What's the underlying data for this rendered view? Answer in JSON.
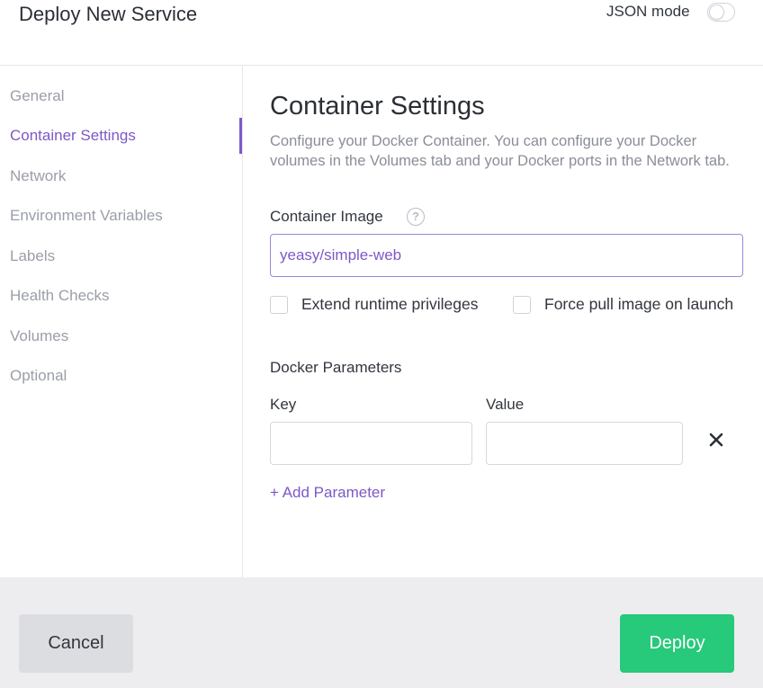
{
  "header": {
    "title": "Deploy New Service",
    "json_mode_label": "JSON mode",
    "json_mode_enabled": false
  },
  "sidebar": {
    "items": [
      {
        "label": "General",
        "active": false
      },
      {
        "label": "Container Settings",
        "active": true
      },
      {
        "label": "Network",
        "active": false
      },
      {
        "label": "Environment Variables",
        "active": false
      },
      {
        "label": "Labels",
        "active": false
      },
      {
        "label": "Health Checks",
        "active": false
      },
      {
        "label": "Volumes",
        "active": false
      },
      {
        "label": "Optional",
        "active": false
      }
    ],
    "accent_color": "#7d58c7"
  },
  "main": {
    "title": "Container Settings",
    "description": "Configure your Docker Container. You can configure your Docker volumes in the Volumes tab and your Docker ports in the Network tab.",
    "container_image": {
      "label": "Container Image",
      "value": "yeasy/simple-web",
      "help_icon": "question-circle-icon"
    },
    "checkboxes": [
      {
        "label": "Extend runtime privileges",
        "checked": false
      },
      {
        "label": "Force pull image on launch",
        "checked": false
      }
    ],
    "docker_parameters": {
      "section_label": "Docker Parameters",
      "key_label": "Key",
      "value_label": "Value",
      "key_value": "",
      "value_value": "",
      "remove_icon": "close-icon",
      "add_label": "+ Add Parameter"
    }
  },
  "footer": {
    "cancel_label": "Cancel",
    "deploy_label": "Deploy",
    "deploy_color": "#27c97a"
  }
}
